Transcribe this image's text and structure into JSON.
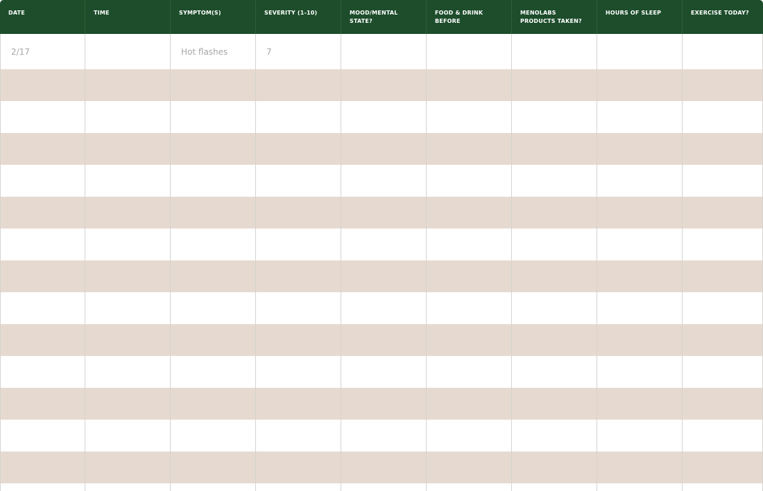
{
  "colors": {
    "header_bg": "#1d4d2b",
    "header_text": "#ffffff",
    "row_alt": "#e6dad0",
    "row_plain": "#ffffff",
    "entry_text": "#a7a7a7"
  },
  "table": {
    "columns": [
      "DATE",
      "TIME",
      "SYMPTOM(S)",
      "SEVERITY (1-10)",
      "MOOD/MENTAL STATE?",
      "FOOD & DRINK BEFORE",
      "MENOLABS PRODUCTS TAKEN?",
      "HOURS OF SLEEP",
      "EXERCISE TODAY?"
    ],
    "rows": [
      [
        "2/17",
        "",
        "Hot flashes",
        "7",
        "",
        "",
        "",
        "",
        ""
      ],
      [
        "",
        "",
        "",
        "",
        "",
        "",
        "",
        "",
        ""
      ],
      [
        "",
        "",
        "",
        "",
        "",
        "",
        "",
        "",
        ""
      ],
      [
        "",
        "",
        "",
        "",
        "",
        "",
        "",
        "",
        ""
      ],
      [
        "",
        "",
        "",
        "",
        "",
        "",
        "",
        "",
        ""
      ],
      [
        "",
        "",
        "",
        "",
        "",
        "",
        "",
        "",
        ""
      ],
      [
        "",
        "",
        "",
        "",
        "",
        "",
        "",
        "",
        ""
      ],
      [
        "",
        "",
        "",
        "",
        "",
        "",
        "",
        "",
        ""
      ],
      [
        "",
        "",
        "",
        "",
        "",
        "",
        "",
        "",
        ""
      ],
      [
        "",
        "",
        "",
        "",
        "",
        "",
        "",
        "",
        ""
      ],
      [
        "",
        "",
        "",
        "",
        "",
        "",
        "",
        "",
        ""
      ],
      [
        "",
        "",
        "",
        "",
        "",
        "",
        "",
        "",
        ""
      ],
      [
        "",
        "",
        "",
        "",
        "",
        "",
        "",
        "",
        ""
      ],
      [
        "",
        "",
        "",
        "",
        "",
        "",
        "",
        "",
        ""
      ],
      [
        "",
        "",
        "",
        "",
        "",
        "",
        "",
        "",
        ""
      ]
    ]
  }
}
